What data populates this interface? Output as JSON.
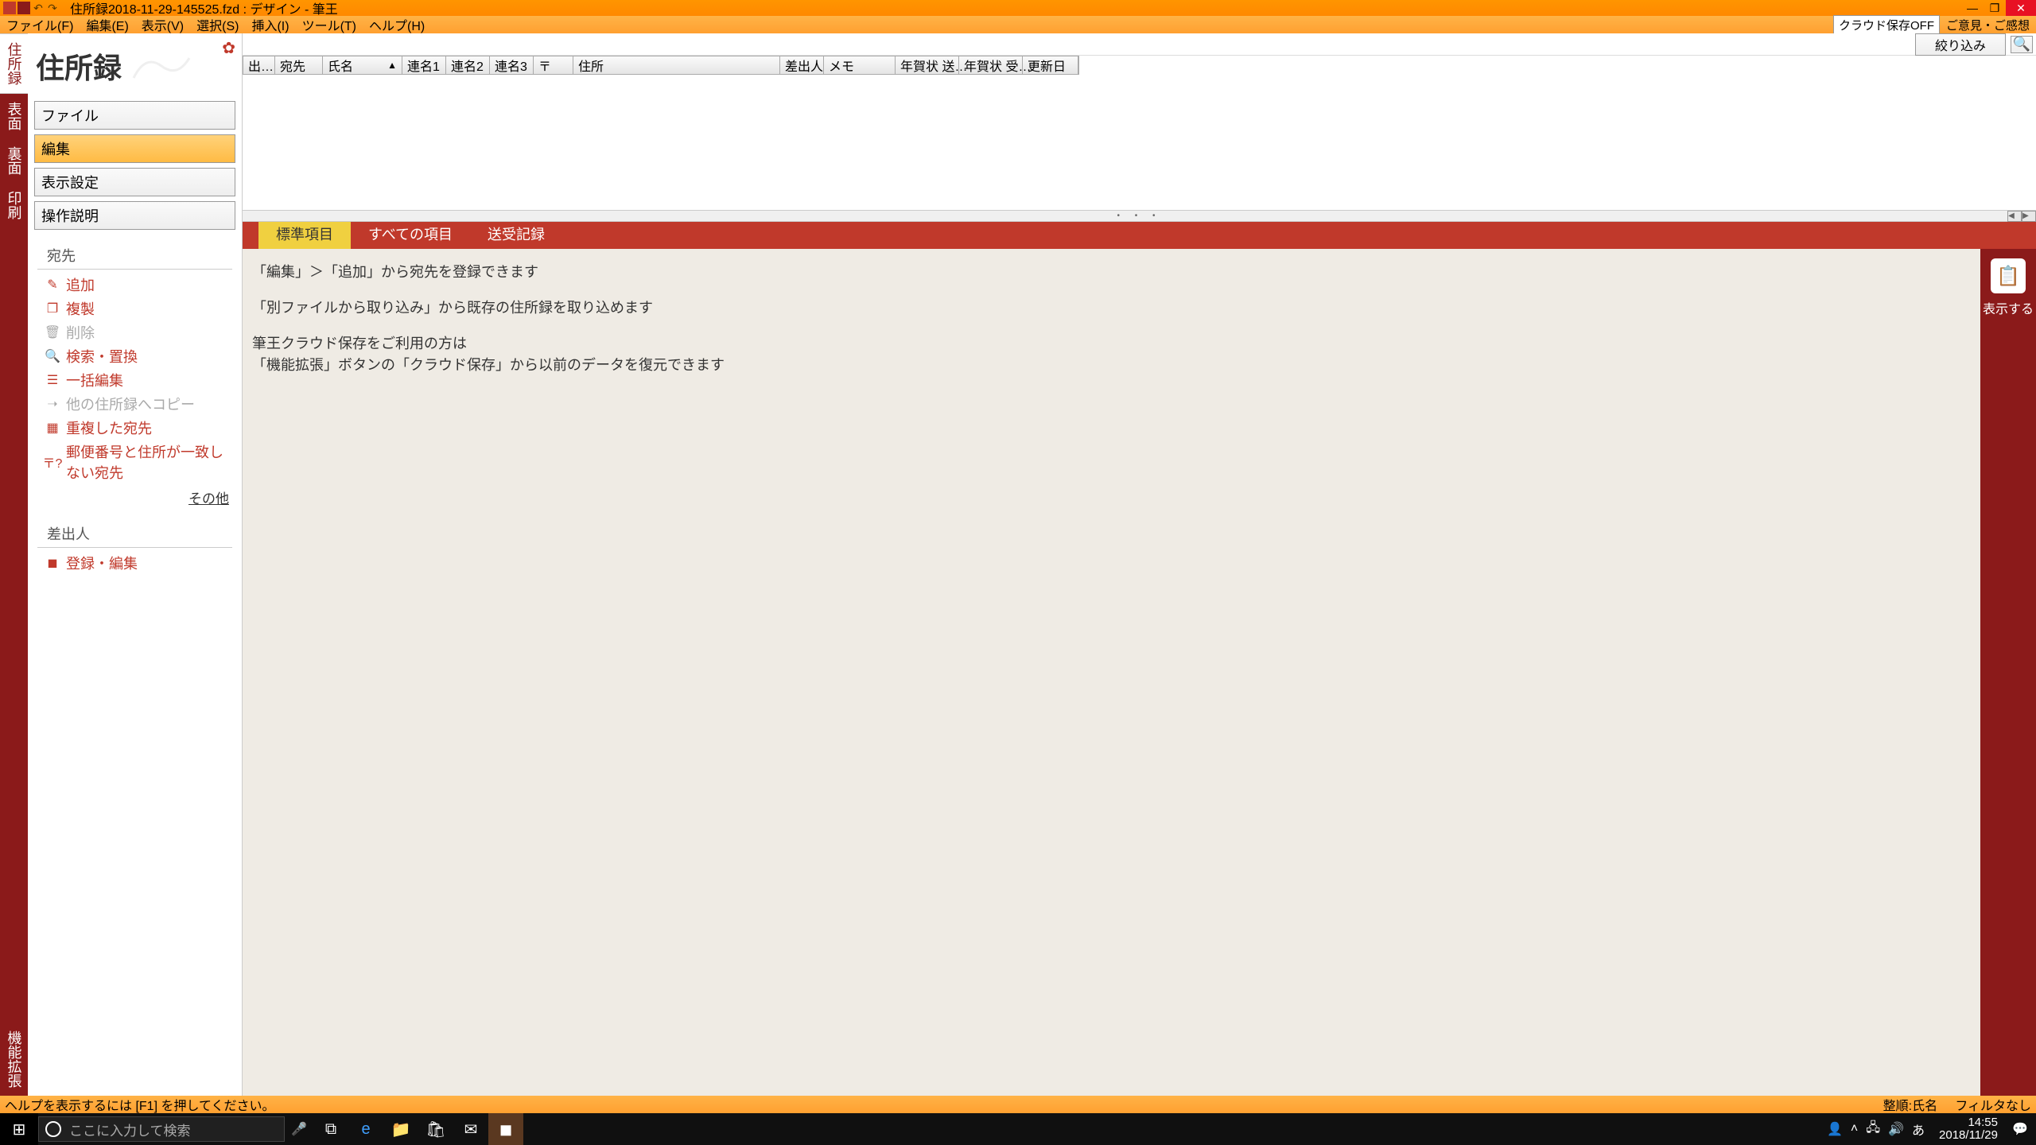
{
  "titlebar": {
    "text": "住所録2018-11-29-145525.fzd : デザイン - 筆王"
  },
  "menubar": {
    "items": [
      "ファイル(F)",
      "編集(E)",
      "表示(V)",
      "選択(S)",
      "挿入(I)",
      "ツール(T)",
      "ヘルプ(H)"
    ],
    "cloud_off": "クラウド保存OFF",
    "feedback": "ご意見・ご感想"
  },
  "vtabs": {
    "items": [
      "住所録",
      "表面",
      "裏面",
      "印刷"
    ],
    "bottom": "機能拡張"
  },
  "sidebar": {
    "title": "住所録",
    "sections": {
      "file": "ファイル",
      "edit": "編集",
      "display": "表示設定",
      "help": "操作説明"
    },
    "group_atesaki": "宛先",
    "items": {
      "add": "追加",
      "copy": "複製",
      "delete": "削除",
      "search": "検索・置換",
      "bulk": "一括編集",
      "othercopy": "他の住所録へコピー",
      "dup": "重複した宛先",
      "mismatch": "郵便番号と住所が一致しない宛先"
    },
    "other": "その他",
    "group_sashidashi": "差出人",
    "register": "登録・編集"
  },
  "toprow": {
    "filter": "絞り込み"
  },
  "grid": {
    "cols": [
      "出…",
      "宛先",
      "氏名",
      "連名1",
      "連名2",
      "連名3",
      "〒",
      "住所",
      "差出人",
      "メモ",
      "年賀状 送…",
      "年賀状 受…",
      "更新日"
    ]
  },
  "tabs": {
    "t1": "標準項目",
    "t2": "すべての項目",
    "t3": "送受記録"
  },
  "detail": {
    "line1": "「編集」＞「追加」から宛先を登録できます",
    "line2": "「別ファイルから取り込み」から既存の住所録を取り込めます",
    "line3": "筆王クラウド保存をご利用の方は",
    "line4": "「機能拡張」ボタンの「クラウド保存」から以前のデータを復元できます"
  },
  "rightbar": {
    "show": "表示する"
  },
  "statusbar": {
    "left": "ヘルプを表示するには [F1] を押してください。",
    "right_order": "整順:氏名",
    "right_filter": "フィルタなし"
  },
  "taskbar": {
    "search_placeholder": "ここに入力して検索",
    "ime": "あ",
    "time": "14:55",
    "date": "2018/11/29"
  }
}
